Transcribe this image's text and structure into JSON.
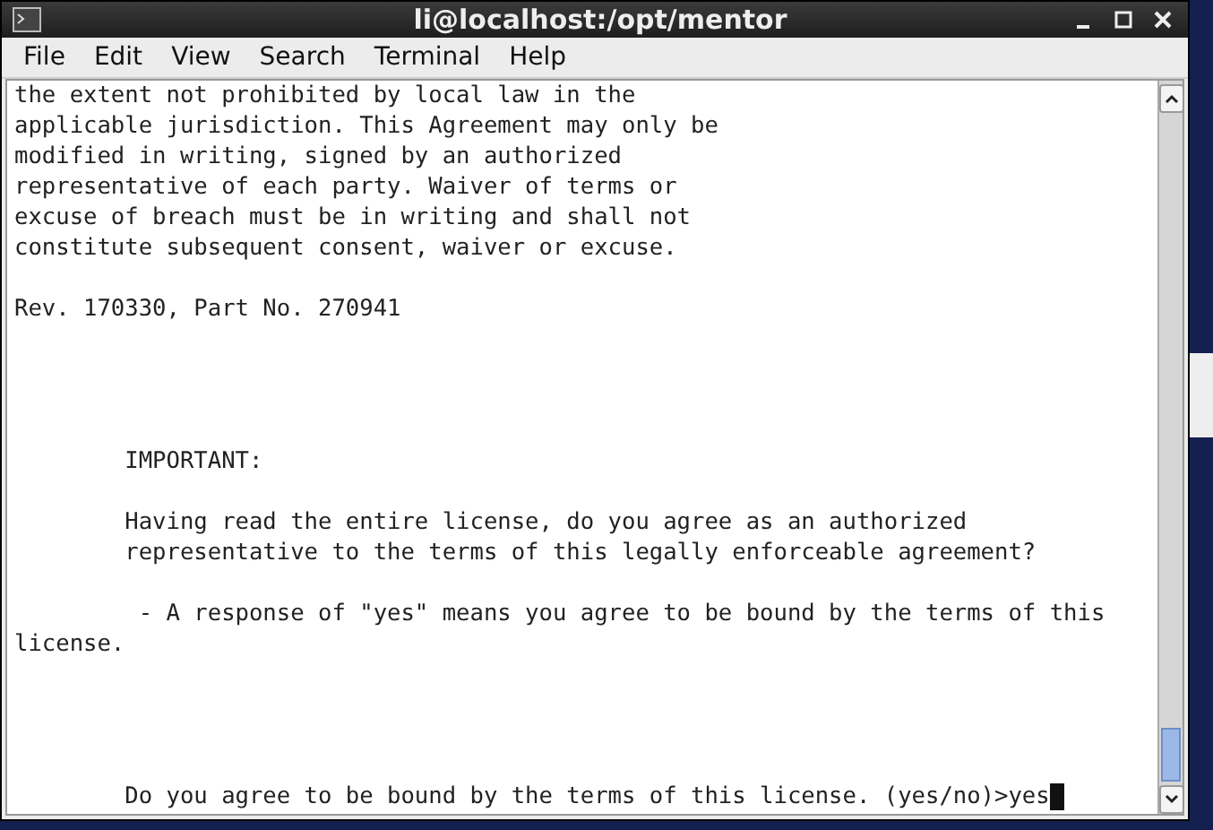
{
  "window": {
    "title": "li@localhost:/opt/mentor"
  },
  "menu": [
    "File",
    "Edit",
    "View",
    "Search",
    "Terminal",
    "Help"
  ],
  "terminal": {
    "lines": [
      {
        "kind": "text",
        "text": "the extent not prohibited by local law in the"
      },
      {
        "kind": "text",
        "text": "applicable jurisdiction. This Agreement may only be"
      },
      {
        "kind": "text",
        "text": "modified in writing, signed by an authorized"
      },
      {
        "kind": "text",
        "text": "representative of each party. Waiver of terms or"
      },
      {
        "kind": "text",
        "text": "excuse of breach must be in writing and shall not"
      },
      {
        "kind": "text",
        "text": "constitute subsequent consent, waiver or excuse."
      },
      {
        "kind": "blank"
      },
      {
        "kind": "text",
        "text": "Rev. 170330, Part No. 270941"
      },
      {
        "kind": "blank"
      },
      {
        "kind": "blank"
      },
      {
        "kind": "blank"
      },
      {
        "kind": "blank"
      },
      {
        "kind": "text",
        "text": "        IMPORTANT:"
      },
      {
        "kind": "blank"
      },
      {
        "kind": "text",
        "text": "        Having read the entire license, do you agree as an authorized"
      },
      {
        "kind": "text",
        "text": "        representative to the terms of this legally enforceable agreement?"
      },
      {
        "kind": "blank"
      },
      {
        "kind": "text",
        "text": "         - A response of \"yes\" means you agree to be bound by the terms of this"
      },
      {
        "kind": "text",
        "text": "license."
      },
      {
        "kind": "blank"
      },
      {
        "kind": "blank"
      },
      {
        "kind": "blank"
      },
      {
        "kind": "blank"
      },
      {
        "kind": "prompt",
        "text": "        Do you agree to be bound by the terms of this license. (yes/no)>yes"
      }
    ]
  }
}
